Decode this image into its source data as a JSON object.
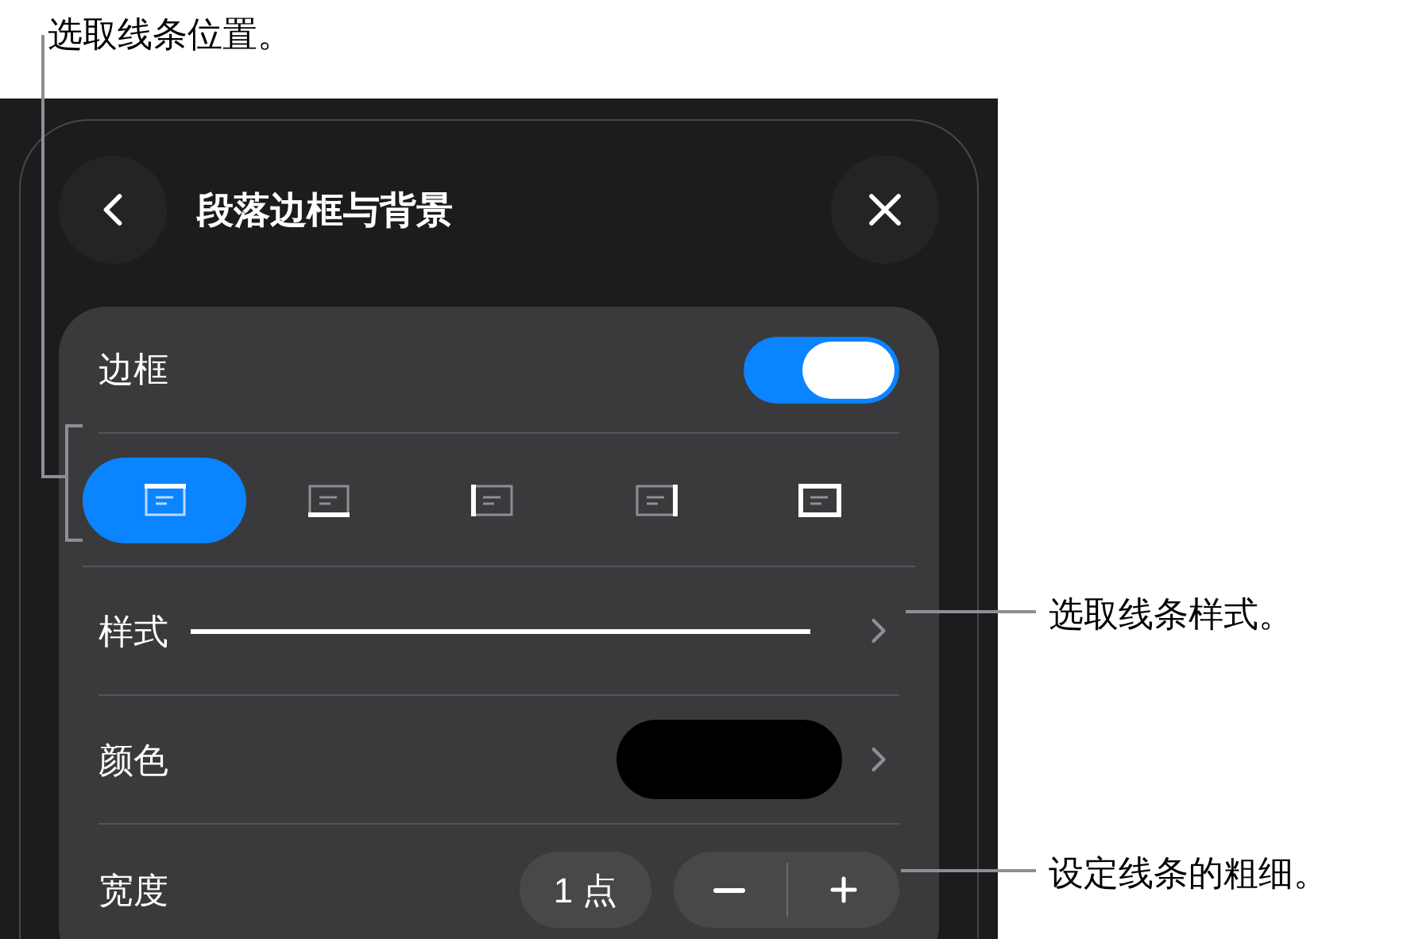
{
  "annotations": [
    {
      "text": "选取线条位置。"
    },
    {
      "text": "选取线条样式。"
    },
    {
      "text": "设定线条的粗细。"
    }
  ],
  "header": {
    "title": "段落边框与背景"
  },
  "border": {
    "label": "边框",
    "on": true
  },
  "positions": [
    {
      "kind": "top",
      "selected": true
    },
    {
      "kind": "bottom",
      "selected": false
    },
    {
      "kind": "left",
      "selected": false
    },
    {
      "kind": "right",
      "selected": false
    },
    {
      "kind": "box",
      "selected": false
    }
  ],
  "style": {
    "label": "样式"
  },
  "color": {
    "label": "颜色"
  },
  "width": {
    "label": "宽度",
    "value": "1 点"
  }
}
